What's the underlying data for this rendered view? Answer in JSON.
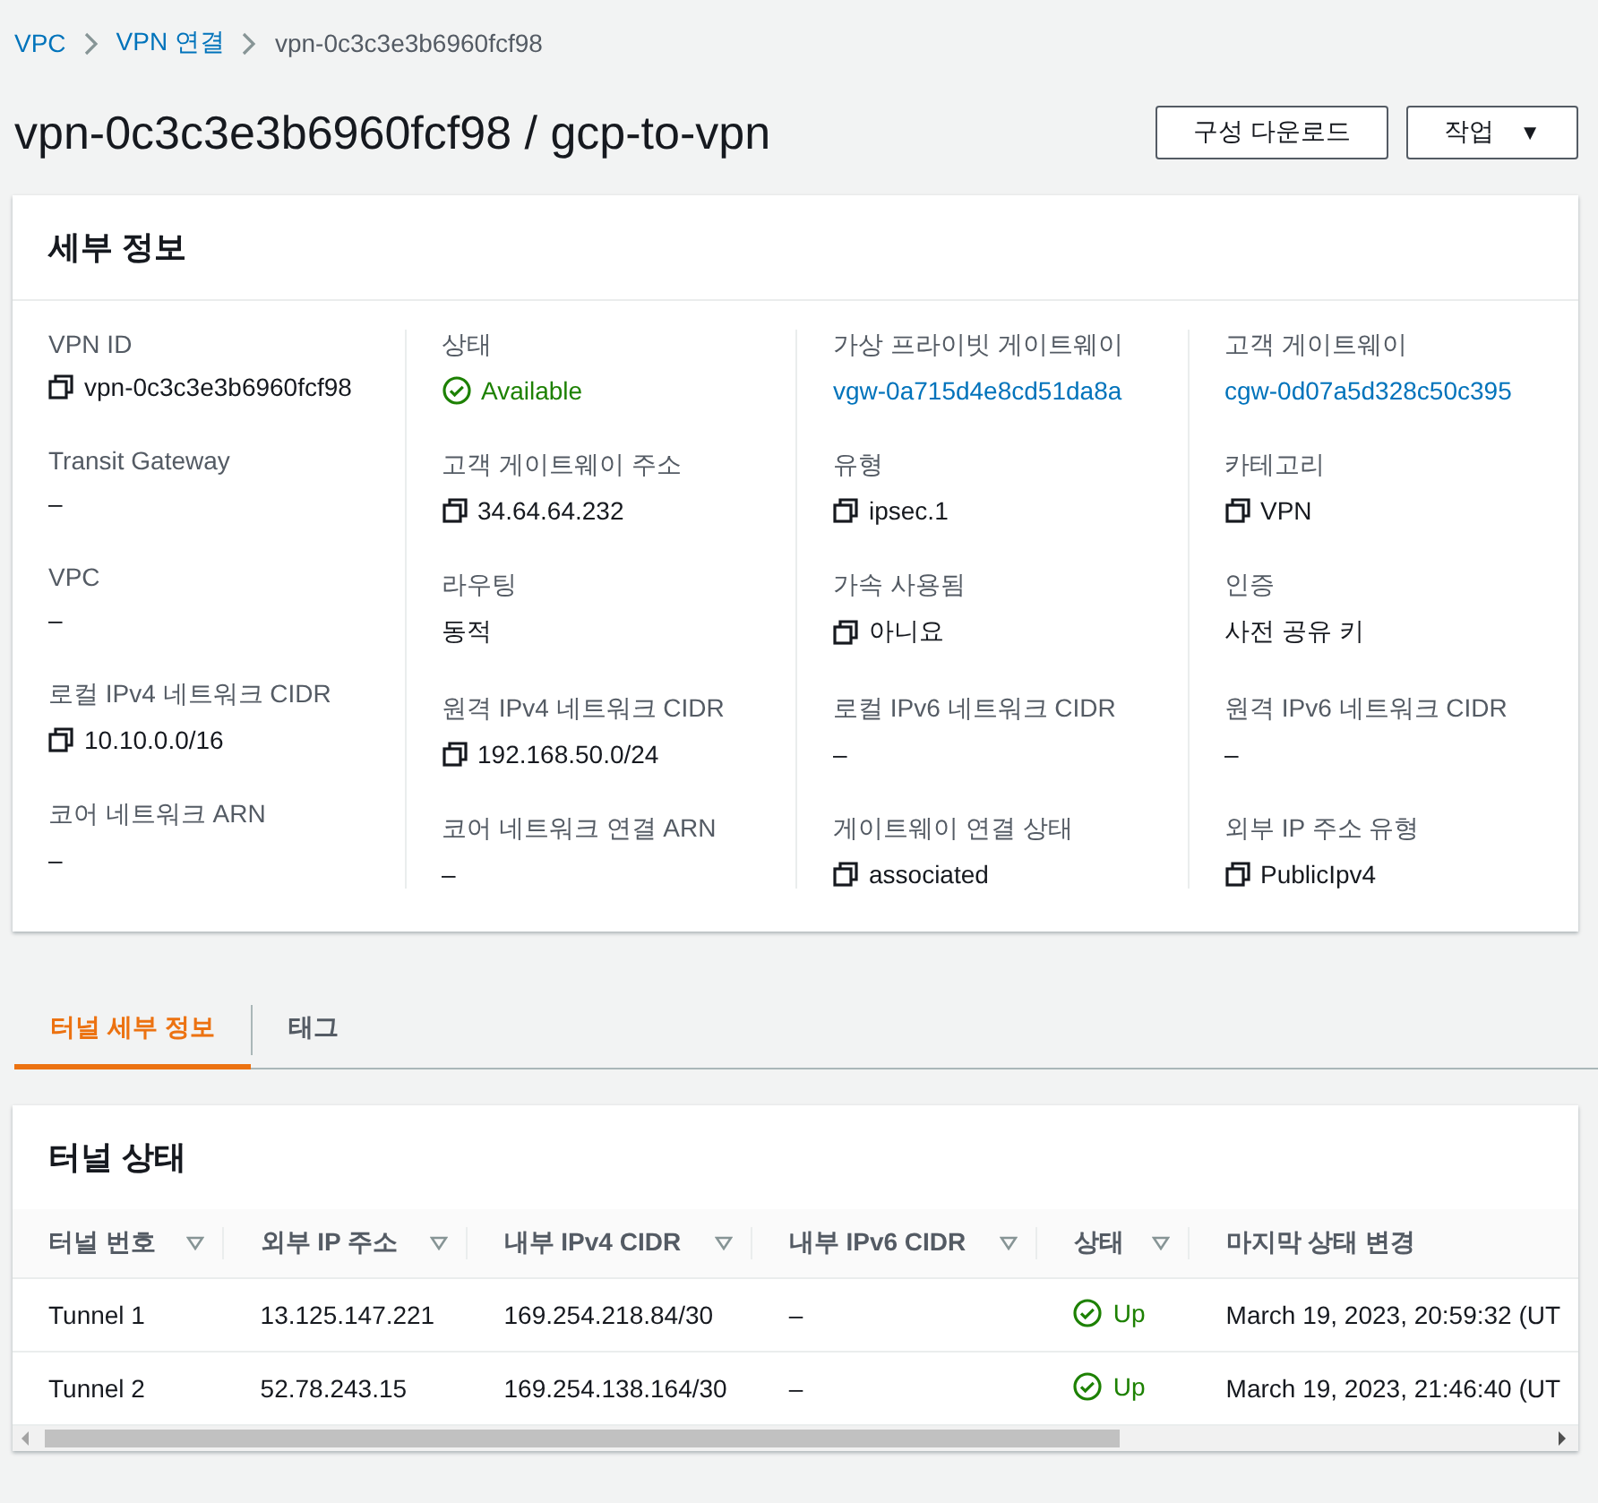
{
  "breadcrumb": [
    {
      "label": "VPC",
      "kind": "link"
    },
    {
      "label": "VPN 연결",
      "kind": "link"
    },
    {
      "label": "vpn-0c3c3e3b6960fcf98",
      "kind": "current"
    }
  ],
  "title": "vpn-0c3c3e3b6960fcf98 / gcp-to-vpn",
  "buttons": [
    {
      "label": "구성 다운로드",
      "kind": "plain"
    },
    {
      "label": "작업",
      "kind": "dropdown",
      "caret": "▼"
    }
  ],
  "details": {
    "heading": "세부 정보",
    "columns": [
      [
        {
          "label": "VPN ID",
          "value": "vpn-0c3c3e3b6960fcf98",
          "kind": "copy"
        },
        {
          "label": "Transit Gateway",
          "value": "–",
          "kind": "text"
        },
        {
          "label": "VPC",
          "value": "–",
          "kind": "text"
        },
        {
          "label": "로컬 IPv4 네트워크 CIDR",
          "value": "10.10.0.0/16",
          "kind": "copy"
        },
        {
          "label": "코어 네트워크 ARN",
          "value": "–",
          "kind": "text"
        }
      ],
      [
        {
          "label": "상태",
          "value": "Available",
          "kind": "status"
        },
        {
          "label": "고객 게이트웨이 주소",
          "value": "34.64.64.232",
          "kind": "copy"
        },
        {
          "label": "라우팅",
          "value": "동적",
          "kind": "text"
        },
        {
          "label": "원격 IPv4 네트워크 CIDR",
          "value": "192.168.50.0/24",
          "kind": "copy"
        },
        {
          "label": "코어 네트워크 연결 ARN",
          "value": "–",
          "kind": "text"
        }
      ],
      [
        {
          "label": "가상 프라이빗 게이트웨이",
          "value": "vgw-0a715d4e8cd51da8a",
          "kind": "link"
        },
        {
          "label": "유형",
          "value": "ipsec.1",
          "kind": "copy"
        },
        {
          "label": "가속 사용됨",
          "value": "아니요",
          "kind": "copy"
        },
        {
          "label": "로컬 IPv6 네트워크 CIDR",
          "value": "–",
          "kind": "text"
        },
        {
          "label": "게이트웨이 연결 상태",
          "value": "associated",
          "kind": "copy"
        }
      ],
      [
        {
          "label": "고객 게이트웨이",
          "value": "cgw-0d07a5d328c50c395",
          "kind": "link"
        },
        {
          "label": "카테고리",
          "value": "VPN",
          "kind": "copy"
        },
        {
          "label": "인증",
          "value": "사전 공유 키",
          "kind": "text"
        },
        {
          "label": "원격 IPv6 네트워크 CIDR",
          "value": "–",
          "kind": "text"
        },
        {
          "label": "외부 IP 주소 유형",
          "value": "PublicIpv4",
          "kind": "copy"
        }
      ]
    ]
  },
  "tabs": [
    {
      "label": "터널 세부 정보",
      "selected": true
    },
    {
      "label": "태그",
      "selected": false
    }
  ],
  "tunnels": {
    "heading": "터널 상태",
    "columns": [
      {
        "label": "터널 번호",
        "sortable": true
      },
      {
        "label": "외부 IP 주소",
        "sortable": true
      },
      {
        "label": "내부 IPv4 CIDR",
        "sortable": true
      },
      {
        "label": "내부 IPv6 CIDR",
        "sortable": true
      },
      {
        "label": "상태",
        "sortable": true
      },
      {
        "label": "마지막 상태 변경",
        "sortable": false
      }
    ],
    "rows": [
      {
        "cells": [
          "Tunnel 1",
          "13.125.147.221",
          "169.254.218.84/30",
          "–"
        ],
        "status": "Up",
        "changed": "March 19, 2023, 20:59:32 (UT"
      },
      {
        "cells": [
          "Tunnel 2",
          "52.78.243.15",
          "169.254.138.164/30",
          "–"
        ],
        "status": "Up",
        "changed": "March 19, 2023, 21:46:40 (UT"
      }
    ]
  }
}
